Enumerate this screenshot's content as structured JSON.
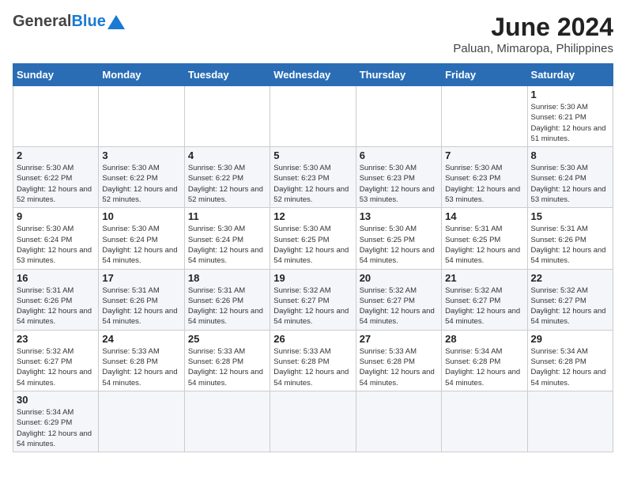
{
  "header": {
    "logo_general": "General",
    "logo_blue": "Blue",
    "title": "June 2024",
    "subtitle": "Paluan, Mimaropa, Philippines"
  },
  "days_of_week": [
    "Sunday",
    "Monday",
    "Tuesday",
    "Wednesday",
    "Thursday",
    "Friday",
    "Saturday"
  ],
  "weeks": [
    [
      {
        "day": "",
        "info": ""
      },
      {
        "day": "",
        "info": ""
      },
      {
        "day": "",
        "info": ""
      },
      {
        "day": "",
        "info": ""
      },
      {
        "day": "",
        "info": ""
      },
      {
        "day": "",
        "info": ""
      },
      {
        "day": "1",
        "info": "Sunrise: 5:30 AM\nSunset: 6:21 PM\nDaylight: 12 hours\nand 51 minutes."
      }
    ],
    [
      {
        "day": "2",
        "info": "Sunrise: 5:30 AM\nSunset: 6:22 PM\nDaylight: 12 hours\nand 52 minutes."
      },
      {
        "day": "3",
        "info": "Sunrise: 5:30 AM\nSunset: 6:22 PM\nDaylight: 12 hours\nand 52 minutes."
      },
      {
        "day": "4",
        "info": "Sunrise: 5:30 AM\nSunset: 6:22 PM\nDaylight: 12 hours\nand 52 minutes."
      },
      {
        "day": "5",
        "info": "Sunrise: 5:30 AM\nSunset: 6:23 PM\nDaylight: 12 hours\nand 52 minutes."
      },
      {
        "day": "6",
        "info": "Sunrise: 5:30 AM\nSunset: 6:23 PM\nDaylight: 12 hours\nand 53 minutes."
      },
      {
        "day": "7",
        "info": "Sunrise: 5:30 AM\nSunset: 6:23 PM\nDaylight: 12 hours\nand 53 minutes."
      },
      {
        "day": "8",
        "info": "Sunrise: 5:30 AM\nSunset: 6:24 PM\nDaylight: 12 hours\nand 53 minutes."
      }
    ],
    [
      {
        "day": "9",
        "info": "Sunrise: 5:30 AM\nSunset: 6:24 PM\nDaylight: 12 hours\nand 53 minutes."
      },
      {
        "day": "10",
        "info": "Sunrise: 5:30 AM\nSunset: 6:24 PM\nDaylight: 12 hours\nand 54 minutes."
      },
      {
        "day": "11",
        "info": "Sunrise: 5:30 AM\nSunset: 6:24 PM\nDaylight: 12 hours\nand 54 minutes."
      },
      {
        "day": "12",
        "info": "Sunrise: 5:30 AM\nSunset: 6:25 PM\nDaylight: 12 hours\nand 54 minutes."
      },
      {
        "day": "13",
        "info": "Sunrise: 5:30 AM\nSunset: 6:25 PM\nDaylight: 12 hours\nand 54 minutes."
      },
      {
        "day": "14",
        "info": "Sunrise: 5:31 AM\nSunset: 6:25 PM\nDaylight: 12 hours\nand 54 minutes."
      },
      {
        "day": "15",
        "info": "Sunrise: 5:31 AM\nSunset: 6:26 PM\nDaylight: 12 hours\nand 54 minutes."
      }
    ],
    [
      {
        "day": "16",
        "info": "Sunrise: 5:31 AM\nSunset: 6:26 PM\nDaylight: 12 hours\nand 54 minutes."
      },
      {
        "day": "17",
        "info": "Sunrise: 5:31 AM\nSunset: 6:26 PM\nDaylight: 12 hours\nand 54 minutes."
      },
      {
        "day": "18",
        "info": "Sunrise: 5:31 AM\nSunset: 6:26 PM\nDaylight: 12 hours\nand 54 minutes."
      },
      {
        "day": "19",
        "info": "Sunrise: 5:32 AM\nSunset: 6:27 PM\nDaylight: 12 hours\nand 54 minutes."
      },
      {
        "day": "20",
        "info": "Sunrise: 5:32 AM\nSunset: 6:27 PM\nDaylight: 12 hours\nand 54 minutes."
      },
      {
        "day": "21",
        "info": "Sunrise: 5:32 AM\nSunset: 6:27 PM\nDaylight: 12 hours\nand 54 minutes."
      },
      {
        "day": "22",
        "info": "Sunrise: 5:32 AM\nSunset: 6:27 PM\nDaylight: 12 hours\nand 54 minutes."
      }
    ],
    [
      {
        "day": "23",
        "info": "Sunrise: 5:32 AM\nSunset: 6:27 PM\nDaylight: 12 hours\nand 54 minutes."
      },
      {
        "day": "24",
        "info": "Sunrise: 5:33 AM\nSunset: 6:28 PM\nDaylight: 12 hours\nand 54 minutes."
      },
      {
        "day": "25",
        "info": "Sunrise: 5:33 AM\nSunset: 6:28 PM\nDaylight: 12 hours\nand 54 minutes."
      },
      {
        "day": "26",
        "info": "Sunrise: 5:33 AM\nSunset: 6:28 PM\nDaylight: 12 hours\nand 54 minutes."
      },
      {
        "day": "27",
        "info": "Sunrise: 5:33 AM\nSunset: 6:28 PM\nDaylight: 12 hours\nand 54 minutes."
      },
      {
        "day": "28",
        "info": "Sunrise: 5:34 AM\nSunset: 6:28 PM\nDaylight: 12 hours\nand 54 minutes."
      },
      {
        "day": "29",
        "info": "Sunrise: 5:34 AM\nSunset: 6:28 PM\nDaylight: 12 hours\nand 54 minutes."
      }
    ],
    [
      {
        "day": "30",
        "info": "Sunrise: 5:34 AM\nSunset: 6:29 PM\nDaylight: 12 hours\nand 54 minutes."
      },
      {
        "day": "",
        "info": ""
      },
      {
        "day": "",
        "info": ""
      },
      {
        "day": "",
        "info": ""
      },
      {
        "day": "",
        "info": ""
      },
      {
        "day": "",
        "info": ""
      },
      {
        "day": "",
        "info": ""
      }
    ]
  ]
}
